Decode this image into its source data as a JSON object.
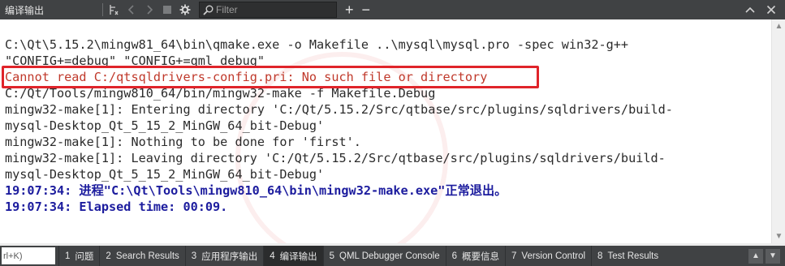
{
  "toolbar": {
    "title": "编译输出",
    "filter_placeholder": "Filter",
    "add_label": "+",
    "remove_label": "−",
    "icons": [
      "clean-icon",
      "back-icon",
      "forward-icon",
      "stop-icon",
      "settings-icon",
      "search-icon",
      "expand-icon",
      "close-icon"
    ]
  },
  "output": {
    "lines": [
      {
        "text": "C:\\Qt\\5.15.2\\mingw81_64\\bin\\qmake.exe -o Makefile ..\\mysql\\mysql.pro -spec win32-g++",
        "kind": "normal"
      },
      {
        "text": "\"CONFIG+=debug\" \"CONFIG+=qml_debug\"",
        "kind": "normal"
      },
      {
        "text": "Cannot read C:/qtsqldrivers-config.pri: No such file or directory",
        "kind": "error"
      },
      {
        "text": "C:/Qt/Tools/mingw810_64/bin/mingw32-make -f Makefile.Debug",
        "kind": "normal"
      },
      {
        "text": "mingw32-make[1]: Entering directory 'C:/Qt/5.15.2/Src/qtbase/src/plugins/sqldrivers/build-",
        "kind": "normal"
      },
      {
        "text": "mysql-Desktop_Qt_5_15_2_MinGW_64_bit-Debug'",
        "kind": "normal"
      },
      {
        "text": "mingw32-make[1]: Nothing to be done for 'first'.",
        "kind": "normal"
      },
      {
        "text": "mingw32-make[1]: Leaving directory 'C:/Qt/5.15.2/Src/qtbase/src/plugins/sqldrivers/build-",
        "kind": "normal"
      },
      {
        "text": "mysql-Desktop_Qt_5_15_2_MinGW_64_bit-Debug'",
        "kind": "normal"
      },
      {
        "text": "19:07:34: 进程\"C:\\Qt\\Tools\\mingw810_64\\bin\\mingw32-make.exe\"正常退出。",
        "kind": "status"
      },
      {
        "text": "19:07:34: Elapsed time: 00:09.",
        "kind": "status"
      }
    ]
  },
  "bottombar": {
    "locator_text": "rl+K)",
    "tabs": [
      {
        "num": "1",
        "label": "问题"
      },
      {
        "num": "2",
        "label": "Search Results"
      },
      {
        "num": "3",
        "label": "应用程序输出"
      },
      {
        "num": "4",
        "label": "编译输出",
        "active": true
      },
      {
        "num": "5",
        "label": "QML Debugger Console"
      },
      {
        "num": "6",
        "label": "概要信息"
      },
      {
        "num": "7",
        "label": "Version Control"
      },
      {
        "num": "8",
        "label": "Test Results"
      }
    ]
  },
  "colors": {
    "toolbar_bg": "#404244",
    "error_text": "#c0392b",
    "status_text": "#1c1c9e",
    "highlight_border": "#e0242a"
  }
}
